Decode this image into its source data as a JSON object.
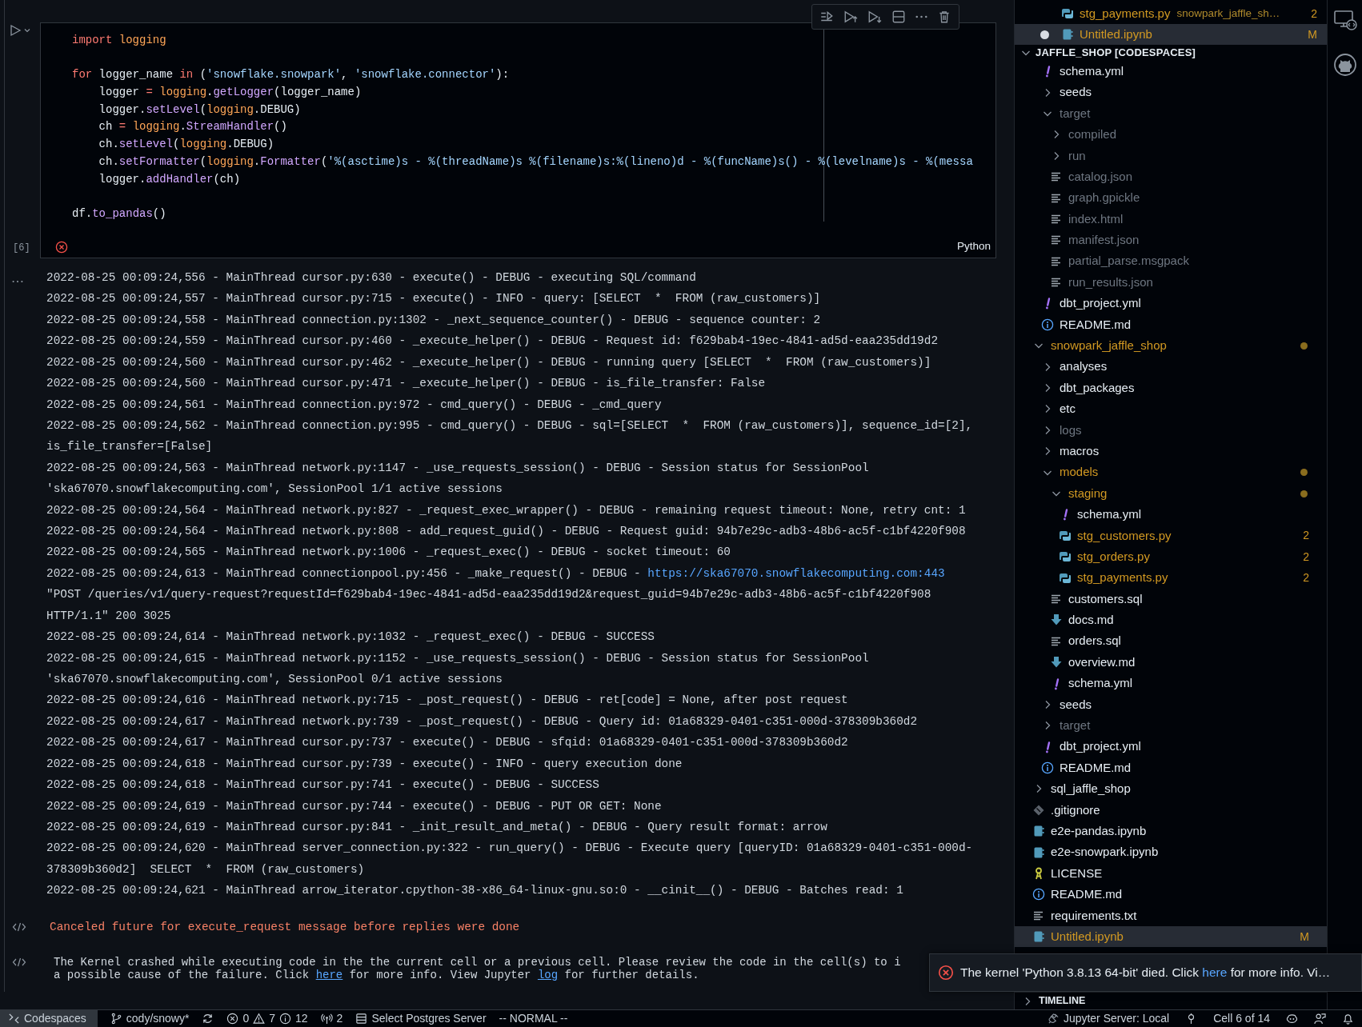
{
  "cell": {
    "execution_count": "[6]",
    "failed": true,
    "language": "Python",
    "code_blocks": [
      [
        [
          {
            "kind": "kw",
            "text": "import "
          },
          {
            "kind": "mod",
            "text": "logging"
          }
        ]
      ],
      [
        [
          {
            "kind": "kw",
            "text": "for"
          },
          {
            "kind": "plain",
            "text": " logger_name "
          },
          {
            "kind": "kw",
            "text": "in"
          },
          {
            "kind": "plain",
            "text": " ("
          },
          {
            "kind": "str",
            "text": "'snowflake.snowpark'"
          },
          {
            "kind": "plain",
            "text": ", "
          },
          {
            "kind": "str",
            "text": "'snowflake.connector'"
          },
          {
            "kind": "plain",
            "text": "):"
          }
        ],
        [
          {
            "kind": "plain",
            "text": "    logger "
          },
          {
            "kind": "kw",
            "text": "= "
          },
          {
            "kind": "mod",
            "text": "logging"
          },
          {
            "kind": "plain",
            "text": "."
          },
          {
            "kind": "fn",
            "text": "getLogger"
          },
          {
            "kind": "plain",
            "text": "(logger_name)"
          }
        ],
        [
          {
            "kind": "plain",
            "text": "    logger."
          },
          {
            "kind": "fn",
            "text": "setLevel"
          },
          {
            "kind": "plain",
            "text": "("
          },
          {
            "kind": "mod",
            "text": "logging"
          },
          {
            "kind": "plain",
            "text": ".DEBUG)"
          }
        ],
        [
          {
            "kind": "plain",
            "text": "    ch "
          },
          {
            "kind": "kw",
            "text": "= "
          },
          {
            "kind": "mod",
            "text": "logging"
          },
          {
            "kind": "plain",
            "text": "."
          },
          {
            "kind": "fn",
            "text": "StreamHandler"
          },
          {
            "kind": "plain",
            "text": "()"
          }
        ],
        [
          {
            "kind": "plain",
            "text": "    ch."
          },
          {
            "kind": "fn",
            "text": "setLevel"
          },
          {
            "kind": "plain",
            "text": "("
          },
          {
            "kind": "mod",
            "text": "logging"
          },
          {
            "kind": "plain",
            "text": ".DEBUG)"
          }
        ],
        [
          {
            "kind": "plain",
            "text": "    ch."
          },
          {
            "kind": "fn",
            "text": "setFormatter"
          },
          {
            "kind": "plain",
            "text": "("
          },
          {
            "kind": "mod",
            "text": "logging"
          },
          {
            "kind": "plain",
            "text": "."
          },
          {
            "kind": "fn",
            "text": "Formatter"
          },
          {
            "kind": "plain",
            "text": "("
          },
          {
            "kind": "str",
            "text": "'%(asctime)s - %(threadName)s %(filename)s:%(lineno)d - %(funcName)s() - %(levelname)s - %(messa"
          }
        ],
        [
          {
            "kind": "plain",
            "text": "    logger."
          },
          {
            "kind": "fn",
            "text": "addHandler"
          },
          {
            "kind": "plain",
            "text": "(ch)"
          }
        ]
      ],
      [
        [
          {
            "kind": "plain",
            "text": "df."
          },
          {
            "kind": "fn",
            "text": "to_pandas"
          },
          {
            "kind": "plain",
            "text": "()"
          }
        ]
      ]
    ]
  },
  "output": {
    "log": [
      {
        "lines": [
          "2022-08-25 00:09:24,556 - MainThread cursor.py:630 - execute() - DEBUG - executing SQL/command"
        ]
      },
      {
        "lines": [
          "2022-08-25 00:09:24,557 - MainThread cursor.py:715 - execute() - INFO - query: [SELECT  *  FROM (raw_customers)]"
        ]
      },
      {
        "lines": [
          "2022-08-25 00:09:24,558 - MainThread connection.py:1302 - _next_sequence_counter() - DEBUG - sequence counter: 2"
        ]
      },
      {
        "lines": [
          "2022-08-25 00:09:24,559 - MainThread cursor.py:460 - _execute_helper() - DEBUG - Request id: f629bab4-19ec-4841-ad5d-eaa235dd19d2"
        ]
      },
      {
        "lines": [
          "2022-08-25 00:09:24,560 - MainThread cursor.py:462 - _execute_helper() - DEBUG - running query [SELECT  *  FROM (raw_customers)]"
        ]
      },
      {
        "lines": [
          "2022-08-25 00:09:24,560 - MainThread cursor.py:471 - _execute_helper() - DEBUG - is_file_transfer: False"
        ]
      },
      {
        "lines": [
          "2022-08-25 00:09:24,561 - MainThread connection.py:972 - cmd_query() - DEBUG - _cmd_query"
        ]
      },
      {
        "lines": [
          "2022-08-25 00:09:24,562 - MainThread connection.py:995 - cmd_query() - DEBUG - sql=[SELECT  *  FROM (raw_customers)], sequence_id=[2],",
          "is_file_transfer=[False]"
        ]
      },
      {
        "lines": [
          "2022-08-25 00:09:24,563 - MainThread network.py:1147 - _use_requests_session() - DEBUG - Session status for SessionPool",
          "'ska67070.snowflakecomputing.com', SessionPool 1/1 active sessions"
        ]
      },
      {
        "lines": [
          "2022-08-25 00:09:24,564 - MainThread network.py:827 - _request_exec_wrapper() - DEBUG - remaining request timeout: None, retry cnt: 1"
        ]
      },
      {
        "lines": [
          "2022-08-25 00:09:24,564 - MainThread network.py:808 - add_request_guid() - DEBUG - Request guid: 94b7e29c-adb3-48b6-ac5f-c1bf4220f908"
        ]
      },
      {
        "lines": [
          "2022-08-25 00:09:24,565 - MainThread network.py:1006 - _request_exec() - DEBUG - socket timeout: 60"
        ]
      },
      {
        "lines": [
          "2022-08-25 00:09:24,613 - MainThread connectionpool.py:456 - _make_request() - DEBUG - ",
          "\"POST /queries/v1/query-request?requestId=f629bab4-19ec-4841-ad5d-eaa235dd19d2&request_guid=94b7e29c-adb3-48b6-ac5f-c1bf4220f908",
          "HTTP/1.1\" 200 3025"
        ],
        "link": "https://ska67070.snowflakecomputing.com:443"
      },
      {
        "lines": [
          "2022-08-25 00:09:24,614 - MainThread network.py:1032 - _request_exec() - DEBUG - SUCCESS"
        ]
      },
      {
        "lines": [
          "2022-08-25 00:09:24,615 - MainThread network.py:1152 - _use_requests_session() - DEBUG - Session status for SessionPool",
          "'ska67070.snowflakecomputing.com', SessionPool 0/1 active sessions"
        ]
      },
      {
        "lines": [
          "2022-08-25 00:09:24,616 - MainThread network.py:715 - _post_request() - DEBUG - ret[code] = None, after post request"
        ]
      },
      {
        "lines": [
          "2022-08-25 00:09:24,617 - MainThread network.py:739 - _post_request() - DEBUG - Query id: 01a68329-0401-c351-000d-378309b360d2"
        ]
      },
      {
        "lines": [
          "2022-08-25 00:09:24,617 - MainThread cursor.py:737 - execute() - DEBUG - sfqid: 01a68329-0401-c351-000d-378309b360d2"
        ]
      },
      {
        "lines": [
          "2022-08-25 00:09:24,618 - MainThread cursor.py:739 - execute() - INFO - query execution done"
        ]
      },
      {
        "lines": [
          "2022-08-25 00:09:24,618 - MainThread cursor.py:741 - execute() - DEBUG - SUCCESS"
        ]
      },
      {
        "lines": [
          "2022-08-25 00:09:24,619 - MainThread cursor.py:744 - execute() - DEBUG - PUT OR GET: None"
        ]
      },
      {
        "lines": [
          "2022-08-25 00:09:24,619 - MainThread cursor.py:841 - _init_result_and_meta() - DEBUG - Query result format: arrow"
        ]
      },
      {
        "lines": [
          "2022-08-25 00:09:24,620 - MainThread server_connection.py:322 - run_query() - DEBUG - Execute query [queryID: 01a68329-0401-c351-000d-",
          "378309b360d2]  SELECT  *  FROM (raw_customers)"
        ]
      },
      {
        "lines": [
          "2022-08-25 00:09:24,621 - MainThread arrow_iterator.cpython-38-x86_64-linux-gnu.so:0 - __cinit__() - DEBUG - Batches read: 1"
        ]
      }
    ],
    "error_text": "Canceled future for execute_request message before replies were done",
    "kernel_message": [
      [
        {
          "kind": "text",
          "text": "The Kernel crashed while executing code in the the current cell or a previous cell. Please review the code in the cell(s) to i"
        }
      ],
      [
        {
          "kind": "text",
          "text": "a possible cause of the failure. Click "
        },
        {
          "kind": "link",
          "text": "here"
        },
        {
          "kind": "text",
          "text": " for more info. View Jupyter "
        },
        {
          "kind": "link",
          "text": "log"
        },
        {
          "kind": "text",
          "text": " for further details."
        }
      ]
    ]
  },
  "open_editors": [
    {
      "name": "stg_payments.py",
      "kind": "python",
      "description": "snowpark_jaffle_sh…",
      "modified": true,
      "ignored": false,
      "badge": "2",
      "dirty": false,
      "selected": false
    },
    {
      "name": "Untitled.ipynb",
      "kind": "notebook",
      "modified": true,
      "ignored": false,
      "badge": "M",
      "dirty": true,
      "selected": true
    }
  ],
  "explorer": {
    "title": "JAFFLE_SHOP [CODESPACES]",
    "expanded": true
  },
  "tree_continued": [
    {
      "name": "schema.yml",
      "kind": "yaml",
      "modified": false,
      "ignored": false,
      "selected": false
    },
    {
      "name": "seeds",
      "kind": "folder",
      "expanded": false,
      "modified": false,
      "ignored": false,
      "dot": false,
      "selected": false
    },
    {
      "name": "target",
      "kind": "folder",
      "expanded": true,
      "modified": false,
      "ignored": true,
      "dot": false,
      "selected": false,
      "children": [
        {
          "name": "compiled",
          "kind": "folder",
          "expanded": false,
          "modified": false,
          "ignored": true,
          "dot": false,
          "selected": false
        },
        {
          "name": "run",
          "kind": "folder",
          "expanded": false,
          "modified": false,
          "ignored": true,
          "dot": false,
          "selected": false
        },
        {
          "name": "catalog.json",
          "kind": "text",
          "modified": false,
          "ignored": true,
          "selected": false
        },
        {
          "name": "graph.gpickle",
          "kind": "text",
          "modified": false,
          "ignored": true,
          "selected": false
        },
        {
          "name": "index.html",
          "kind": "text",
          "modified": false,
          "ignored": true,
          "selected": false
        },
        {
          "name": "manifest.json",
          "kind": "text",
          "modified": false,
          "ignored": true,
          "selected": false
        },
        {
          "name": "partial_parse.msgpack",
          "kind": "text",
          "modified": false,
          "ignored": true,
          "selected": false
        },
        {
          "name": "run_results.json",
          "kind": "text",
          "modified": false,
          "ignored": true,
          "selected": false
        }
      ]
    },
    {
      "name": "dbt_project.yml",
      "kind": "yaml",
      "modified": false,
      "ignored": false,
      "selected": false
    },
    {
      "name": "README.md",
      "kind": "info",
      "modified": false,
      "ignored": false,
      "selected": false
    }
  ],
  "tree": [
    {
      "name": "snowpark_jaffle_shop",
      "kind": "folder",
      "expanded": true,
      "modified": true,
      "ignored": false,
      "dot": true,
      "selected": false,
      "children": [
        {
          "name": "analyses",
          "kind": "folder",
          "expanded": false,
          "modified": false,
          "ignored": false,
          "dot": false,
          "selected": false
        },
        {
          "name": "dbt_packages",
          "kind": "folder",
          "expanded": false,
          "modified": false,
          "ignored": false,
          "dot": false,
          "selected": false
        },
        {
          "name": "etc",
          "kind": "folder",
          "expanded": false,
          "modified": false,
          "ignored": false,
          "dot": false,
          "selected": false
        },
        {
          "name": "logs",
          "kind": "folder",
          "expanded": false,
          "modified": false,
          "ignored": true,
          "dot": false,
          "selected": false
        },
        {
          "name": "macros",
          "kind": "folder",
          "expanded": false,
          "modified": false,
          "ignored": false,
          "dot": false,
          "selected": false
        },
        {
          "name": "models",
          "kind": "folder",
          "expanded": true,
          "modified": true,
          "ignored": false,
          "dot": true,
          "selected": false,
          "children": [
            {
              "name": "staging",
              "kind": "folder",
              "expanded": true,
              "modified": true,
              "ignored": false,
              "dot": true,
              "selected": false,
              "children": [
                {
                  "name": "schema.yml",
                  "kind": "yaml",
                  "modified": false,
                  "ignored": false,
                  "selected": false
                },
                {
                  "name": "stg_customers.py",
                  "kind": "python",
                  "modified": true,
                  "ignored": false,
                  "badge": "2",
                  "selected": false
                },
                {
                  "name": "stg_orders.py",
                  "kind": "python",
                  "modified": true,
                  "ignored": false,
                  "badge": "2",
                  "selected": false
                },
                {
                  "name": "stg_payments.py",
                  "kind": "python",
                  "modified": true,
                  "ignored": false,
                  "badge": "2",
                  "selected": false
                }
              ]
            },
            {
              "name": "customers.sql",
              "kind": "text",
              "modified": false,
              "ignored": false,
              "selected": false
            },
            {
              "name": "docs.md",
              "kind": "markdown",
              "modified": false,
              "ignored": false,
              "selected": false
            },
            {
              "name": "orders.sql",
              "kind": "text",
              "modified": false,
              "ignored": false,
              "selected": false
            },
            {
              "name": "overview.md",
              "kind": "markdown",
              "modified": false,
              "ignored": false,
              "selected": false
            },
            {
              "name": "schema.yml",
              "kind": "yaml",
              "modified": false,
              "ignored": false,
              "selected": false
            }
          ]
        },
        {
          "name": "seeds",
          "kind": "folder",
          "expanded": false,
          "modified": false,
          "ignored": false,
          "dot": false,
          "selected": false
        },
        {
          "name": "target",
          "kind": "folder",
          "expanded": false,
          "modified": false,
          "ignored": true,
          "dot": false,
          "selected": false
        },
        {
          "name": "dbt_project.yml",
          "kind": "yaml",
          "modified": false,
          "ignored": false,
          "selected": false
        },
        {
          "name": "README.md",
          "kind": "info",
          "modified": false,
          "ignored": false,
          "selected": false
        }
      ]
    },
    {
      "name": "sql_jaffle_shop",
      "kind": "folder",
      "expanded": false,
      "modified": false,
      "ignored": false,
      "dot": false,
      "selected": false
    },
    {
      "name": ".gitignore",
      "kind": "git",
      "modified": false,
      "ignored": false,
      "selected": false
    },
    {
      "name": "e2e-pandas.ipynb",
      "kind": "notebook",
      "modified": false,
      "ignored": false,
      "selected": false
    },
    {
      "name": "e2e-snowpark.ipynb",
      "kind": "notebook",
      "modified": false,
      "ignored": false,
      "selected": false
    },
    {
      "name": "LICENSE",
      "kind": "license",
      "modified": false,
      "ignored": false,
      "selected": false
    },
    {
      "name": "README.md",
      "kind": "info",
      "modified": false,
      "ignored": false,
      "selected": false
    },
    {
      "name": "requirements.txt",
      "kind": "text",
      "modified": false,
      "ignored": false,
      "selected": false
    },
    {
      "name": "Untitled.ipynb",
      "kind": "notebook",
      "modified": true,
      "ignored": false,
      "badge": "M",
      "selected": true
    }
  ],
  "timeline": {
    "title": "TIMELINE",
    "expanded": false
  },
  "notification": {
    "kind": "error",
    "segments": [
      {
        "kind": "text",
        "text": "The kernel 'Python 3.8.13 64-bit' died. Click "
      },
      {
        "kind": "link",
        "text": "here"
      },
      {
        "kind": "text",
        "text": " for more info. Vi…"
      }
    ]
  },
  "status_bar": {
    "left": [
      {
        "kind": "remote",
        "text": "Codespaces"
      },
      {
        "kind": "branch",
        "text": "cody/snowy*"
      },
      {
        "kind": "sync"
      },
      {
        "kind": "problems",
        "errors": "0",
        "warnings": "7",
        "infos": "12"
      },
      {
        "kind": "ports",
        "text": "2"
      },
      {
        "kind": "database",
        "text": "Select Postgres Server"
      },
      {
        "kind": "mode",
        "text": "-- NORMAL --"
      }
    ],
    "right": [
      {
        "kind": "jupyter",
        "text": "Jupyter Server: Local"
      },
      {
        "kind": "pin"
      },
      {
        "kind": "cell",
        "text": "Cell 6 of 14"
      },
      {
        "kind": "copilot"
      },
      {
        "kind": "feedback"
      },
      {
        "kind": "notifications"
      }
    ]
  }
}
